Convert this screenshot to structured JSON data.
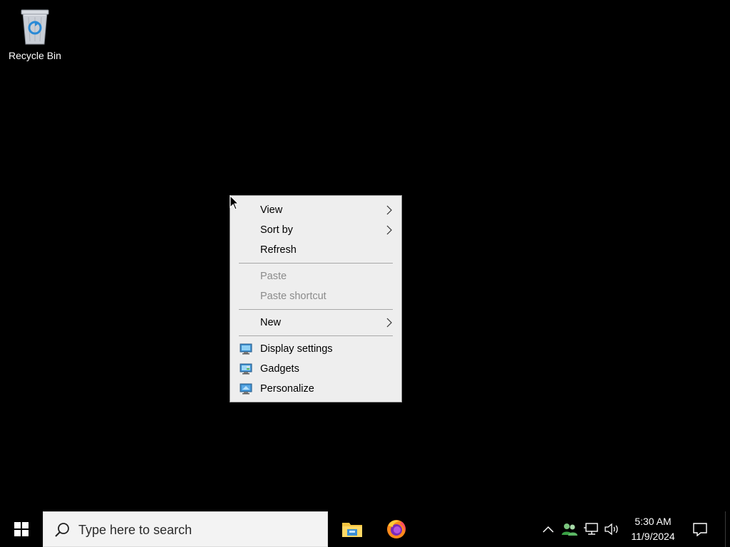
{
  "desktop": {
    "icons": [
      {
        "label": "Recycle Bin",
        "icon": "recycle-bin-icon"
      }
    ]
  },
  "context_menu": {
    "items": [
      {
        "label": "View",
        "submenu": true,
        "enabled": true
      },
      {
        "label": "Sort by",
        "submenu": true,
        "enabled": true
      },
      {
        "label": "Refresh",
        "submenu": false,
        "enabled": true
      },
      {
        "label": "Paste",
        "submenu": false,
        "enabled": false
      },
      {
        "label": "Paste shortcut",
        "submenu": false,
        "enabled": false
      },
      {
        "label": "New",
        "submenu": true,
        "enabled": true
      },
      {
        "label": "Display settings",
        "icon": "display-settings-icon",
        "enabled": true
      },
      {
        "label": "Gadgets",
        "icon": "gadgets-icon",
        "enabled": true
      },
      {
        "label": "Personalize",
        "icon": "personalize-icon",
        "enabled": true
      }
    ]
  },
  "taskbar": {
    "start_icon": "windows-logo-icon",
    "search": {
      "placeholder": "Type here to search"
    },
    "pinned_apps": [
      {
        "name": "File Explorer",
        "icon": "file-explorer-icon"
      },
      {
        "name": "Firefox",
        "icon": "firefox-icon"
      }
    ],
    "tray": {
      "icons": [
        "chevron-up-icon",
        "users-icon",
        "network-icon",
        "volume-icon"
      ],
      "time": "5:30 AM",
      "date": "11/9/2024",
      "notification_icon": "action-center-icon"
    }
  },
  "colors": {
    "desktop_bg": "#000000",
    "menu_bg": "#eeeeee",
    "disabled_text": "#8b8b8b",
    "taskbar_bg": "#000000"
  }
}
